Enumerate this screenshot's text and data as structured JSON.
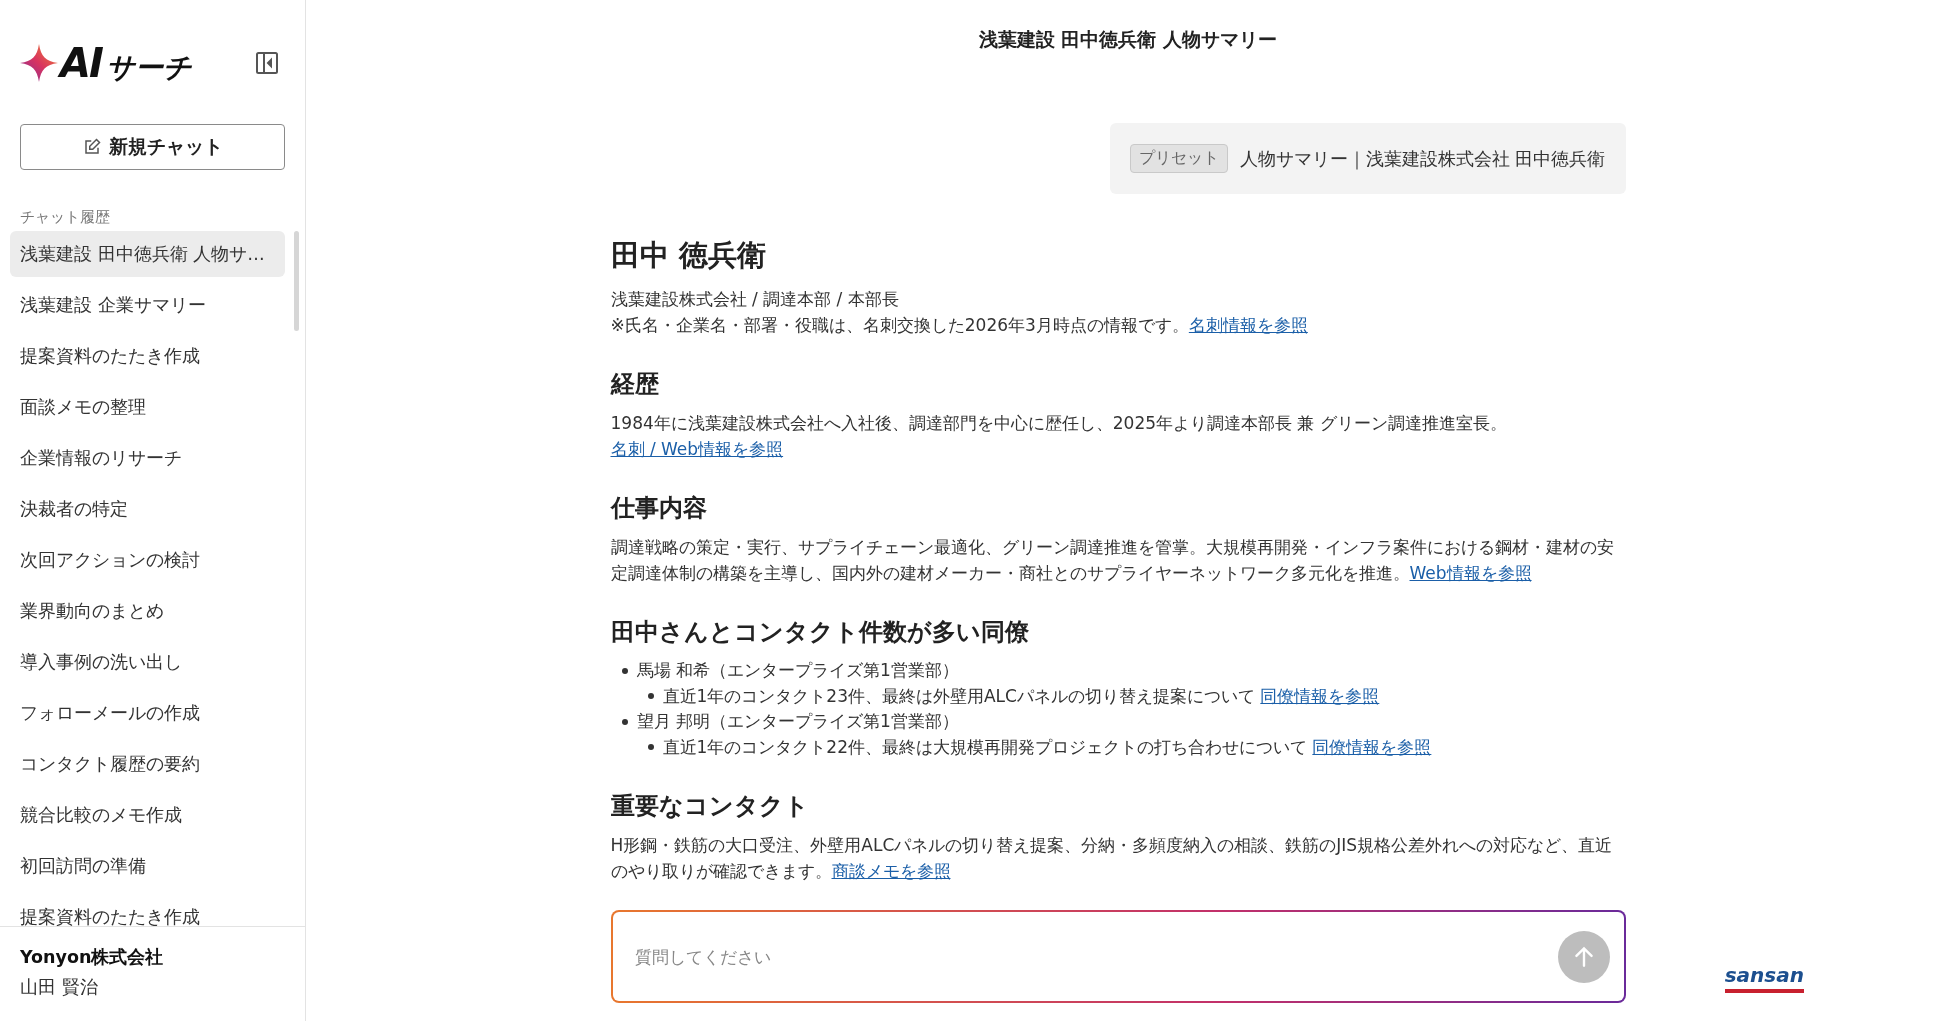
{
  "sidebar": {
    "logo": {
      "mark": "AI",
      "text": "サーチ"
    },
    "new_chat": "新規チャット",
    "history_label": "チャット履歴",
    "items": [
      {
        "label": "浅葉建設 田中徳兵衛 人物サ…",
        "selected": true
      },
      {
        "label": "浅葉建設 企業サマリー",
        "selected": false
      },
      {
        "label": "提案資料のたたき作成",
        "selected": false
      },
      {
        "label": "面談メモの整理",
        "selected": false
      },
      {
        "label": "企業情報のリサーチ",
        "selected": false
      },
      {
        "label": "決裁者の特定",
        "selected": false
      },
      {
        "label": "次回アクションの検討",
        "selected": false
      },
      {
        "label": "業界動向のまとめ",
        "selected": false
      },
      {
        "label": "導入事例の洗い出し",
        "selected": false
      },
      {
        "label": "フォローメールの作成",
        "selected": false
      },
      {
        "label": "コンタクト履歴の要約",
        "selected": false
      },
      {
        "label": "競合比較のメモ作成",
        "selected": false
      },
      {
        "label": "初回訪問の準備",
        "selected": false
      },
      {
        "label": "提案資料のたたき作成",
        "selected": false
      }
    ],
    "user": {
      "company": "Yonyon株式会社",
      "name": "山田 賢治"
    }
  },
  "chat": {
    "title": "浅葉建設 田中徳兵衛 人物サマリー",
    "preset": {
      "tag": "プリセット",
      "text": "人物サマリー｜浅葉建設株式会社 田中徳兵衛"
    },
    "person_name": "田中 徳兵衛",
    "intro": [
      {
        "text": "浅葉建設株式会社 / 調達本部 / 本部長"
      },
      {
        "text": "※氏名・企業名・部署・役職は、名刺交換した2026年3月時点の情報です。",
        "link": "名刺情報を参照"
      }
    ],
    "sections": [
      {
        "kind": "paragraph",
        "heading": "経歴",
        "lines": [
          {
            "text": "1984年に浅葉建設株式会社へ入社後、調達部門を中心に歴任し、2025年より調達本部長 兼 グリーン調達推進室長。"
          },
          {
            "link": "名刺 / Web情報を参照"
          }
        ]
      },
      {
        "kind": "paragraph",
        "heading": "仕事内容",
        "lines": [
          {
            "text": "調達戦略の策定・実行、サプライチェーン最適化、グリーン調達推進を管掌。大規模再開発・インフラ案件における鋼材・建材の安定調達体制の構築を主導し、国内外の建材メーカー・商社とのサプライヤーネットワーク多元化を推進。",
            "link": "Web情報を参照"
          }
        ]
      },
      {
        "kind": "list",
        "heading": "田中さんとコンタクト件数が多い同僚",
        "items": [
          {
            "text": "馬場 和希（エンタープライズ第1営業部）",
            "children": [
              {
                "text": "直近1年のコンタクト23件、最終は外壁用ALCパネルの切り替え提案について",
                "link": "同僚情報を参照"
              }
            ]
          },
          {
            "text": "望月 邦明（エンタープライズ第1営業部）",
            "children": [
              {
                "text": "直近1年のコンタクト22件、最終は大規模再開発プロジェクトの打ち合わせについて",
                "link": "同僚情報を参照"
              }
            ]
          }
        ]
      },
      {
        "kind": "paragraph",
        "heading": "重要なコンタクト",
        "lines": [
          {
            "text": "H形鋼・鉄筋の大口受注、外壁用ALCパネルの切り替え提案、分納・多頻度納入の相談、鉄筋のJIS規格公差外れへの対応など、直近のやり取りが確認できます。",
            "link": "商談メモを参照"
          }
        ]
      }
    ],
    "input": {
      "placeholder": "質問してください",
      "send_disabled": true
    }
  },
  "brand": "sansan"
}
